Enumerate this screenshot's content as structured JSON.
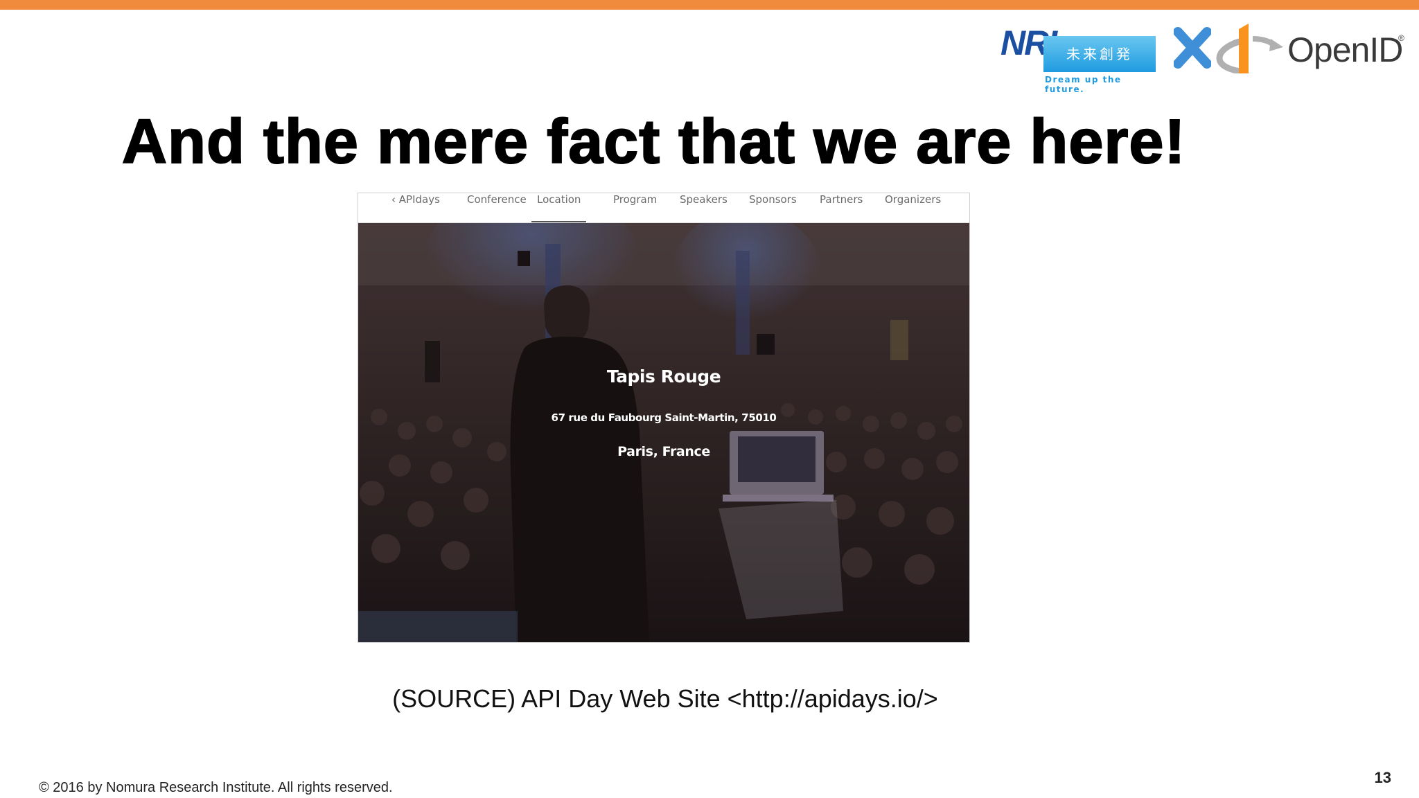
{
  "slide": {
    "title": "And the mere fact that we are here!",
    "caption": "(SOURCE) API Day Web Site <http://apidays.io/>",
    "copyright": "© 2016 by Nomura Research Institute. All rights reserved.",
    "page_number": "13"
  },
  "logos": {
    "nri_wordmark": "NRI",
    "nri_kanji": "未来創発",
    "nri_tagline": "Dream up the future.",
    "times_icon": "times-icon",
    "openid_mark": "openid-logo-icon",
    "openid_wordmark": "OpenID",
    "openid_registered": "®"
  },
  "screenshot": {
    "nav": [
      {
        "label": "‹  APIdays"
      },
      {
        "label": "Conference"
      },
      {
        "label": "Location"
      },
      {
        "label": "Program"
      },
      {
        "label": "Speakers"
      },
      {
        "label": "Sponsors"
      },
      {
        "label": "Partners"
      },
      {
        "label": "Organizers"
      }
    ],
    "active_nav": "Location",
    "venue_name": "Tapis Rouge",
    "venue_address": "67 rue du Faubourg Saint-Martin, 75010",
    "venue_city": "Paris, France"
  },
  "colors": {
    "top_bar": "#f08a3c",
    "nri_blue": "#1a4fa2",
    "nri_light_blue": "#1f9be0",
    "times_blue": "#3f8fd8",
    "openid_orange": "#f7931e",
    "openid_gray": "#b0b0b0"
  }
}
